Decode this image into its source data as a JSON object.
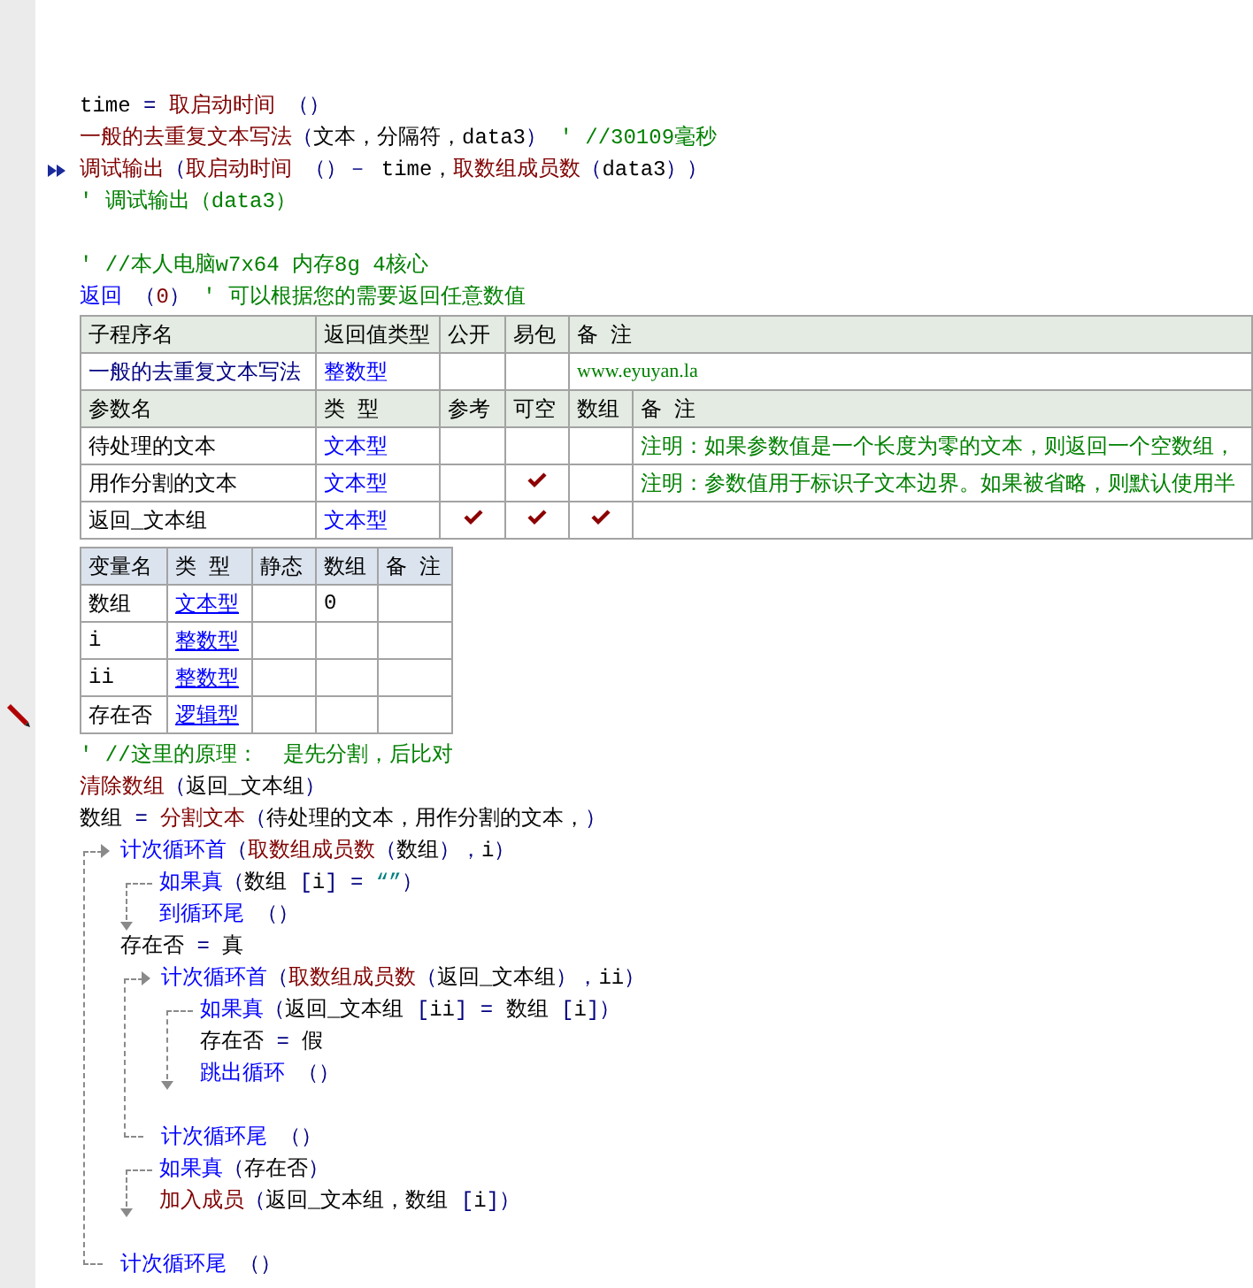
{
  "top_lines": [
    {
      "kind": "line",
      "current": false,
      "tokens": [
        {
          "kind": "plain",
          "text": "time"
        },
        {
          "kind": "punct",
          "text": " = "
        },
        {
          "kind": "func",
          "text": "取启动时间"
        },
        {
          "kind": "punct",
          "text": " （）"
        }
      ]
    },
    {
      "kind": "line",
      "current": false,
      "tokens": [
        {
          "kind": "func",
          "text": "一般的去重复文本写法"
        },
        {
          "kind": "punct",
          "text": "（"
        },
        {
          "kind": "plain",
          "text": "文本，分隔符，data3"
        },
        {
          "kind": "punct",
          "text": "）"
        },
        {
          "kind": "note",
          "text": " ' //30109毫秒"
        }
      ]
    },
    {
      "kind": "line",
      "current": true,
      "tokens": [
        {
          "kind": "func",
          "text": "调试输出"
        },
        {
          "kind": "punct",
          "text": "（"
        },
        {
          "kind": "func",
          "text": "取启动时间"
        },
        {
          "kind": "punct",
          "text": " （）－ "
        },
        {
          "kind": "plain",
          "text": "time，"
        },
        {
          "kind": "func",
          "text": "取数组成员数"
        },
        {
          "kind": "punct",
          "text": "（"
        },
        {
          "kind": "plain",
          "text": "data3"
        },
        {
          "kind": "punct",
          "text": "））"
        }
      ]
    },
    {
      "kind": "line",
      "current": false,
      "tokens": [
        {
          "kind": "note",
          "text": "' 调试输出（data3）"
        }
      ]
    },
    {
      "kind": "blank"
    },
    {
      "kind": "line",
      "current": false,
      "tokens": [
        {
          "kind": "note",
          "text": "' //本人电脑w7x64 内存8g 4核心"
        }
      ]
    },
    {
      "kind": "line",
      "current": false,
      "tokens": [
        {
          "kind": "cmd",
          "text": "返回"
        },
        {
          "kind": "punct",
          "text": " （"
        },
        {
          "kind": "num",
          "text": "0"
        },
        {
          "kind": "punct",
          "text": "）"
        },
        {
          "kind": "note",
          "text": " ' 可以根据您的需要返回任意数值"
        }
      ]
    }
  ],
  "subroutine_table": {
    "header": [
      "子程序名",
      "返回值类型",
      "公开",
      "易包",
      "备 注"
    ],
    "row": {
      "name": "一般的去重复文本写法",
      "return_type": "整数型",
      "public": false,
      "easy_package": false,
      "note": "www.eyuyan.la"
    },
    "param_header": [
      "参数名",
      "类 型",
      "参考",
      "可空",
      "数组",
      "备 注"
    ],
    "params": [
      {
        "name": "待处理的文本",
        "type": "文本型",
        "reference": false,
        "nullable": false,
        "array": false,
        "note": "注明：如果参数值是一个长度为零的文本，则返回一个空数组，"
      },
      {
        "name": "用作分割的文本",
        "type": "文本型",
        "reference": false,
        "nullable": true,
        "array": false,
        "note": "注明：参数值用于标识子文本边界。如果被省略，则默认使用半"
      },
      {
        "name": "返回_文本组",
        "type": "文本型",
        "reference": true,
        "nullable": true,
        "array": true
      }
    ]
  },
  "variable_table": {
    "header": [
      "变量名",
      "类 型",
      "静态",
      "数组",
      "备 注"
    ],
    "rows": [
      {
        "name": "数组",
        "type": "文本型",
        "static": false,
        "array": "0",
        "edited": false
      },
      {
        "name": "i",
        "type": "整数型",
        "static": false,
        "edited": false
      },
      {
        "name": "ii",
        "type": "整数型",
        "static": false,
        "edited": false
      },
      {
        "name": "存在否",
        "type": "逻辑型",
        "static": false,
        "edited": true
      }
    ]
  },
  "body": [
    {
      "kind": "line",
      "tokens": [
        {
          "kind": "note",
          "text": "' //这里的原理：  是先分割，后比对"
        }
      ]
    },
    {
      "kind": "line",
      "tokens": [
        {
          "kind": "func",
          "text": "清除数组"
        },
        {
          "kind": "punct",
          "text": "（"
        },
        {
          "kind": "plain",
          "text": "返回_文本组"
        },
        {
          "kind": "punct",
          "text": "）"
        }
      ]
    },
    {
      "kind": "line",
      "tokens": [
        {
          "kind": "plain",
          "text": "数组"
        },
        {
          "kind": "punct",
          "text": " = "
        },
        {
          "kind": "func",
          "text": "分割文本"
        },
        {
          "kind": "punct",
          "text": "（"
        },
        {
          "kind": "plain",
          "text": "待处理的文本，用作分割的文本，"
        },
        {
          "kind": "punct",
          "text": "）"
        }
      ]
    },
    {
      "kind": "loop",
      "head": [
        {
          "kind": "cmd",
          "text": "计次循环首"
        },
        {
          "kind": "punct",
          "text": "（"
        },
        {
          "kind": "func",
          "text": "取数组成员数"
        },
        {
          "kind": "punct",
          "text": "（"
        },
        {
          "kind": "plain",
          "text": "数组"
        },
        {
          "kind": "punct",
          "text": "），"
        },
        {
          "kind": "plain",
          "text": "i"
        },
        {
          "kind": "punct",
          "text": "）"
        }
      ],
      "children": [
        {
          "kind": "if",
          "head": [
            {
              "kind": "cmd",
              "text": "如果真"
            },
            {
              "kind": "punct",
              "text": "（"
            },
            {
              "kind": "plain",
              "text": "数组"
            },
            {
              "kind": "punct",
              "text": " ["
            },
            {
              "kind": "plain",
              "text": "i"
            },
            {
              "kind": "punct",
              "text": "] = "
            },
            {
              "kind": "str",
              "text": "“”"
            },
            {
              "kind": "punct",
              "text": "）"
            }
          ],
          "children": [
            {
              "kind": "line",
              "tokens": [
                {
                  "kind": "cmd",
                  "text": "到循环尾"
                },
                {
                  "kind": "punct",
                  "text": " （）"
                }
              ]
            }
          ]
        },
        {
          "kind": "line",
          "tokens": [
            {
              "kind": "plain",
              "text": "存在否"
            },
            {
              "kind": "punct",
              "text": " = "
            },
            {
              "kind": "plain",
              "text": "真"
            }
          ]
        },
        {
          "kind": "loop",
          "head": [
            {
              "kind": "cmd",
              "text": "计次循环首"
            },
            {
              "kind": "punct",
              "text": "（"
            },
            {
              "kind": "func",
              "text": "取数组成员数"
            },
            {
              "kind": "punct",
              "text": "（"
            },
            {
              "kind": "plain",
              "text": "返回_文本组"
            },
            {
              "kind": "punct",
              "text": "），"
            },
            {
              "kind": "plain",
              "text": "ii"
            },
            {
              "kind": "punct",
              "text": "）"
            }
          ],
          "children": [
            {
              "kind": "if",
              "head": [
                {
                  "kind": "cmd",
                  "text": "如果真"
                },
                {
                  "kind": "punct",
                  "text": "（"
                },
                {
                  "kind": "plain",
                  "text": "返回_文本组"
                },
                {
                  "kind": "punct",
                  "text": " ["
                },
                {
                  "kind": "plain",
                  "text": "ii"
                },
                {
                  "kind": "punct",
                  "text": "] = "
                },
                {
                  "kind": "plain",
                  "text": "数组"
                },
                {
                  "kind": "punct",
                  "text": " ["
                },
                {
                  "kind": "plain",
                  "text": "i"
                },
                {
                  "kind": "punct",
                  "text": "]）"
                }
              ],
              "children": [
                {
                  "kind": "line",
                  "tokens": [
                    {
                      "kind": "plain",
                      "text": "存在否"
                    },
                    {
                      "kind": "punct",
                      "text": " = "
                    },
                    {
                      "kind": "plain",
                      "text": "假"
                    }
                  ]
                },
                {
                  "kind": "line",
                  "tokens": [
                    {
                      "kind": "cmd",
                      "text": "跳出循环"
                    },
                    {
                      "kind": "punct",
                      "text": " （）"
                    }
                  ]
                }
              ]
            },
            {
              "kind": "blank"
            }
          ],
          "tail": [
            {
              "kind": "cmd",
              "text": "计次循环尾"
            },
            {
              "kind": "punct",
              "text": " （）"
            }
          ]
        },
        {
          "kind": "if",
          "head": [
            {
              "kind": "cmd",
              "text": "如果真"
            },
            {
              "kind": "punct",
              "text": "（"
            },
            {
              "kind": "plain",
              "text": "存在否"
            },
            {
              "kind": "punct",
              "text": "）"
            }
          ],
          "children": [
            {
              "kind": "line",
              "tokens": [
                {
                  "kind": "func",
                  "text": "加入成员"
                },
                {
                  "kind": "punct",
                  "text": "（"
                },
                {
                  "kind": "plain",
                  "text": "返回_文本组，数组"
                },
                {
                  "kind": "punct",
                  "text": " ["
                },
                {
                  "kind": "plain",
                  "text": "i"
                },
                {
                  "kind": "punct",
                  "text": "]）"
                }
              ]
            }
          ]
        },
        {
          "kind": "blank"
        }
      ],
      "tail": [
        {
          "kind": "cmd",
          "text": "计次循环尾"
        },
        {
          "kind": "punct",
          "text": " （）"
        }
      ]
    }
  ]
}
